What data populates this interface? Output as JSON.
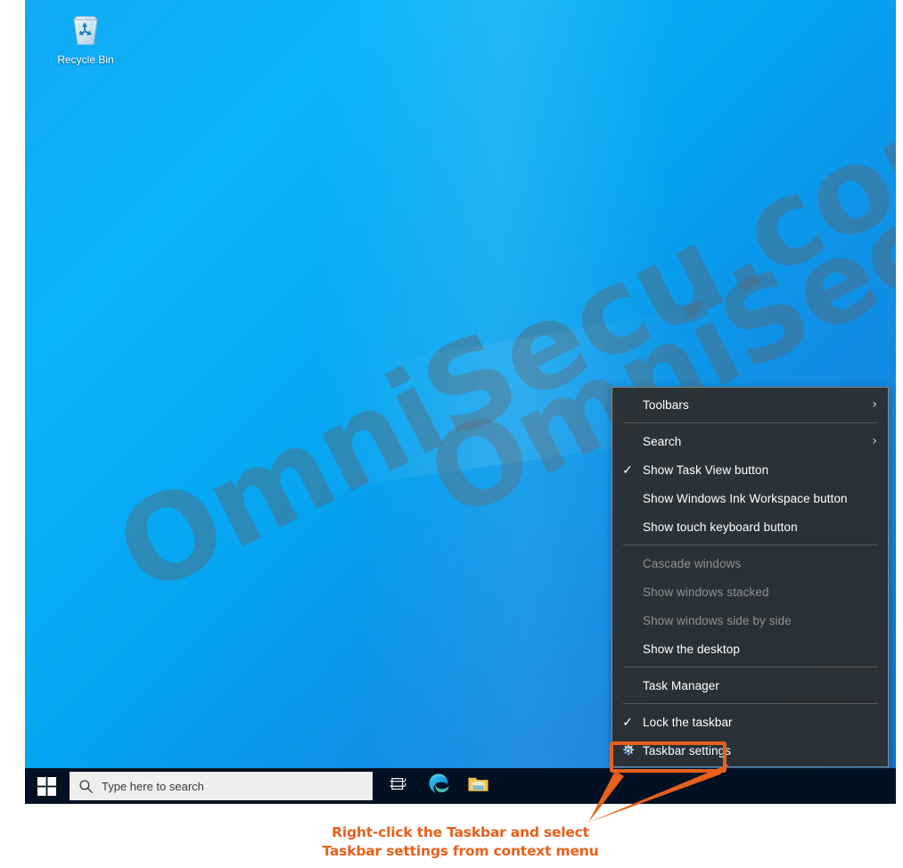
{
  "desktop": {
    "watermark_text": "OmniSecu.com",
    "icons": [
      {
        "name": "recycle-bin",
        "label": "Recycle Bin"
      }
    ],
    "wallpaper_color": "#0ab4fa"
  },
  "context_menu": {
    "groups": [
      {
        "items": [
          {
            "label": "Toolbars",
            "checked": false,
            "disabled": false,
            "submenu": true,
            "arrow": "›",
            "icon": ""
          }
        ]
      },
      {
        "items": [
          {
            "label": "Search",
            "checked": false,
            "disabled": false,
            "submenu": true,
            "arrow": "›",
            "icon": ""
          },
          {
            "label": "Show Task View button",
            "checked": true,
            "disabled": false,
            "submenu": false,
            "arrow": "",
            "icon": ""
          },
          {
            "label": "Show Windows Ink Workspace button",
            "checked": false,
            "disabled": false,
            "submenu": false,
            "arrow": "",
            "icon": ""
          },
          {
            "label": "Show touch keyboard button",
            "checked": false,
            "disabled": false,
            "submenu": false,
            "arrow": "",
            "icon": ""
          }
        ]
      },
      {
        "items": [
          {
            "label": "Cascade windows",
            "checked": false,
            "disabled": true,
            "submenu": false,
            "arrow": "",
            "icon": ""
          },
          {
            "label": "Show windows stacked",
            "checked": false,
            "disabled": true,
            "submenu": false,
            "arrow": "",
            "icon": ""
          },
          {
            "label": "Show windows side by side",
            "checked": false,
            "disabled": true,
            "submenu": false,
            "arrow": "",
            "icon": ""
          },
          {
            "label": "Show the desktop",
            "checked": false,
            "disabled": false,
            "submenu": false,
            "arrow": "",
            "icon": ""
          }
        ]
      },
      {
        "items": [
          {
            "label": "Task Manager",
            "checked": false,
            "disabled": false,
            "submenu": false,
            "arrow": "",
            "icon": ""
          }
        ]
      },
      {
        "items": [
          {
            "label": "Lock the taskbar",
            "checked": true,
            "disabled": false,
            "submenu": false,
            "arrow": "",
            "icon": ""
          },
          {
            "label": "Taskbar settings",
            "checked": false,
            "disabled": false,
            "submenu": false,
            "arrow": "",
            "icon": "gear-icon"
          }
        ]
      }
    ],
    "check_glyph": "✓",
    "highlighted_item": "Taskbar settings",
    "highlight_color": "#e8601c"
  },
  "taskbar": {
    "start_button": "start-button",
    "search": {
      "placeholder": "Type here to search",
      "icon": "search-icon"
    },
    "buttons": [
      {
        "name": "task-view-button",
        "icon": "task-view-icon",
        "label": "Task View"
      },
      {
        "name": "edge-button",
        "icon": "edge-icon",
        "label": "Microsoft Edge"
      },
      {
        "name": "file-explorer-button",
        "icon": "folder-icon",
        "label": "File Explorer"
      }
    ]
  },
  "caption": {
    "line1": "Right-click the Taskbar and select",
    "line2": "Taskbar settings from context menu",
    "color": "#e8601c"
  }
}
